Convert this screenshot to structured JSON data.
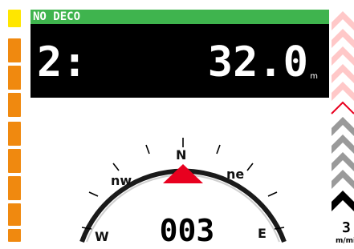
{
  "status": {
    "label": "NO DECO"
  },
  "readout": {
    "time": "2:",
    "depth": "32.0",
    "depth_unit": "m"
  },
  "compass": {
    "heading": "003",
    "labels": {
      "n": "N",
      "ne": "ne",
      "nw": "nw",
      "e": "E",
      "w": "W"
    },
    "needle_color": "#e8001f"
  },
  "ascent": {
    "rate_value": "3",
    "rate_unit": "m/min"
  },
  "colors": {
    "status_green": "#3fb44e",
    "left_bar_top": "#ffe600",
    "left_bar": "#f0890f",
    "chevron_light": "#ffc8c8",
    "chevron_gray": "#9a9a9a",
    "chevron_black": "#000000"
  }
}
